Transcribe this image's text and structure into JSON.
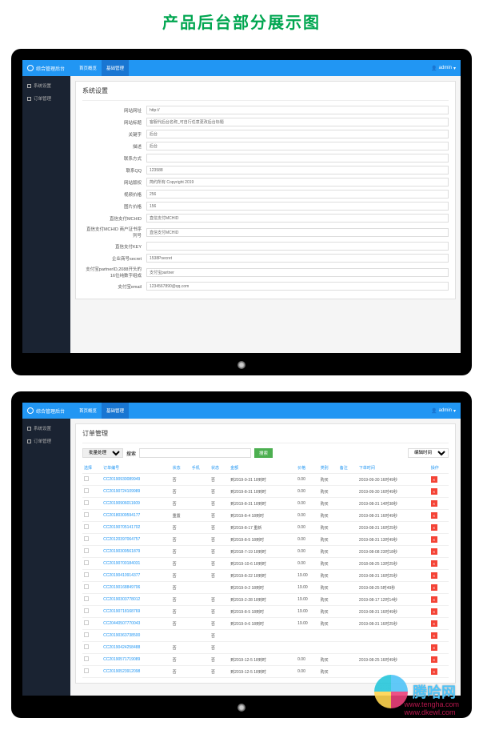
{
  "page_heading": "产品后台部分展示图",
  "brand_text": "综合管理后台",
  "topbar_tabs": [
    "首页概览",
    "基础管理"
  ],
  "user_label": "admin",
  "sidebar_items": [
    "系统设置",
    "订单管理"
  ],
  "screen1": {
    "title": "系统设置",
    "rows": [
      {
        "label": "网站网址",
        "value": "http://"
      },
      {
        "label": "网站标题",
        "value": "客服代后台名称_可自行任意更改后台标题"
      },
      {
        "label": "关键字",
        "value": "后台"
      },
      {
        "label": "描述",
        "value": "后台"
      },
      {
        "label": "联系方式",
        "value": ""
      },
      {
        "label": "联系QQ",
        "value": "123588"
      },
      {
        "label": "网站版权",
        "value": "简约所有 Copyright 2019"
      },
      {
        "label": "视频价格",
        "value": "256"
      },
      {
        "label": "图片价格",
        "value": "156"
      },
      {
        "label": "直信支付MCHID",
        "value": "直信支付MCHID"
      },
      {
        "label": "直信支付MCHID 商户证书序列号",
        "value": "直信支付MCHID"
      },
      {
        "label": "直信支付KEY",
        "value": ""
      },
      {
        "label": "企业商号secret",
        "value": "1538Psecret"
      },
      {
        "label": "支付宝partnerID,2088开头的16位纯数字组成",
        "value": "支付宝partner"
      },
      {
        "label": "支付宝email",
        "value": "1234567890@qq.com"
      }
    ]
  },
  "screen2": {
    "title": "订单管理",
    "batch_label": "批量处理",
    "search_label": "搜索",
    "search_btn": "搜索",
    "time_filter": "编辑时间",
    "columns": [
      "选择",
      "订单编号",
      "状态",
      "手机",
      "状态",
      "金额",
      "价格",
      "类别",
      "备注",
      "下单时间",
      "操作"
    ],
    "rows": [
      {
        "id": "CC20190930089949",
        "a": "否",
        "b": "",
        "c": "否",
        "d": "到2019-9-31 18到时",
        "e": "0.00",
        "f": "购买",
        "g": "",
        "h": "2019-09-30 16时49秒"
      },
      {
        "id": "CC20190724109989",
        "a": "否",
        "b": "",
        "c": "否",
        "d": "到2019-8-31 18到时",
        "e": "0.00",
        "f": "购买",
        "g": "",
        "h": "2019-09-30 16时49秒"
      },
      {
        "id": "CC20190906011609",
        "a": "否",
        "b": "",
        "c": "否",
        "d": "到2019-8-31 18到时",
        "e": "0.00",
        "f": "购买",
        "g": "",
        "h": "2019-08-31 14时38秒"
      },
      {
        "id": "CC20180309594177",
        "a": "重置",
        "b": "",
        "c": "否",
        "d": "到2019-8-4 18到时",
        "e": "0.00",
        "f": "购买",
        "g": "",
        "h": "2019-08-31 16时49秒"
      },
      {
        "id": "CC20190705141702",
        "a": "否",
        "b": "",
        "c": "否",
        "d": "到2019-8-17 重新",
        "e": "0.00",
        "f": "购买",
        "g": "",
        "h": "2019-08-31 16时25秒"
      },
      {
        "id": "CC20120397064757",
        "a": "否",
        "b": "",
        "c": "否",
        "d": "到2019-8-5 18到时",
        "e": "0.00",
        "f": "购买",
        "g": "",
        "h": "2019-08-31 13时49秒"
      },
      {
        "id": "CC20190309561879",
        "a": "否",
        "b": "",
        "c": "否",
        "d": "到2018-7-19 18到时",
        "e": "0.00",
        "f": "购买",
        "g": "",
        "h": "2019-08-08 23时18秒"
      },
      {
        "id": "CC20190700184031",
        "a": "否",
        "b": "",
        "c": "否",
        "d": "到2019-10-6 18到时",
        "e": "0.00",
        "f": "购买",
        "g": "",
        "h": "2018-08-25 13时25秒"
      },
      {
        "id": "CC20190410914377",
        "a": "否",
        "b": "",
        "c": "否",
        "d": "到2019-8-22 18到时",
        "e": "19.00",
        "f": "购买",
        "g": "",
        "h": "2019-08-31 16时25秒"
      },
      {
        "id": "CC20190168849706",
        "a": "否",
        "b": "",
        " ": "否",
        "d": "到2019-9-2 18到时",
        "e": "19.00",
        "f": "购买",
        "g": "",
        "h": "2019-08-25 5时49秒"
      },
      {
        "id": "CC20190303778012",
        "a": "否",
        "b": "",
        "c": "否",
        "d": "到2019-2-28 18到时",
        "e": "19.00",
        "f": "购买",
        "g": "",
        "h": "2019-08-17 12时14秒"
      },
      {
        "id": "CC20190718168769",
        "a": "否",
        "b": "",
        "c": "否",
        "d": "到2019-8-5 18到时",
        "e": "19.00",
        "f": "购买",
        "g": "",
        "h": "2019-08-31 16时49秒"
      },
      {
        "id": "CC20440507770043",
        "a": "否",
        "b": "",
        "c": "否",
        "d": "到2019-9-6 18到时",
        "e": "19.00",
        "f": "购买",
        "g": "",
        "h": "2019-08-31 16时25秒"
      },
      {
        "id": "CC20190363738500",
        "a": "",
        "b": "",
        "c": "否",
        "d": "",
        "e": "",
        "f": "",
        "g": "",
        "h": ""
      },
      {
        "id": "CC20190424258488",
        "a": "否",
        "b": "",
        "c": "否",
        "d": "",
        "e": "",
        "f": "",
        "g": "",
        "h": ""
      },
      {
        "id": "CC20190571719089",
        "a": "否",
        "b": "",
        "c": "否",
        "d": "到2019-12-5 18到时",
        "e": "0.00",
        "f": "购买",
        "g": "",
        "h": "2019-08-25 16时49秒"
      },
      {
        "id": "CC20190523912098",
        "a": "否",
        "b": "",
        "c": "否",
        "d": "到2019-12-5 18到时",
        "e": "0.00",
        "f": "购买",
        "g": "",
        "h": ""
      }
    ]
  },
  "watermark": {
    "brand": "腾哈网",
    "url1": "www.tengha.com",
    "url2": "www.dkewl.com"
  }
}
